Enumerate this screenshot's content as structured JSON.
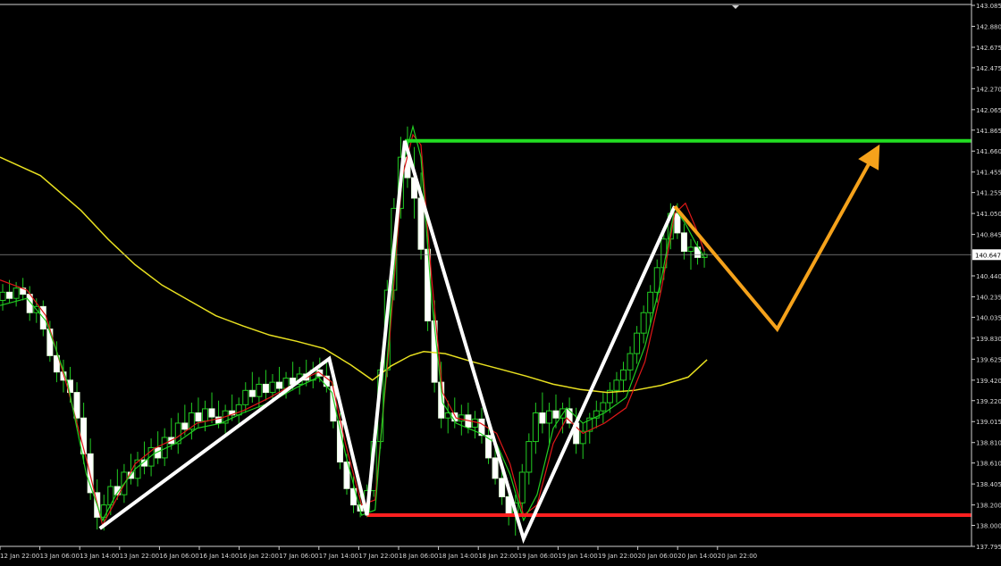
{
  "chart_data": {
    "type": "candlestick",
    "instrument_note": "",
    "y_axis": {
      "ylim": [
        137.795,
        143.085
      ],
      "tick_labels": [
        "143.085",
        "142.880",
        "142.675",
        "142.475",
        "142.270",
        "142.065",
        "141.865",
        "141.660",
        "141.455",
        "141.255",
        "141.050",
        "140.845",
        "140.440",
        "140.235",
        "140.035",
        "139.830",
        "139.625",
        "139.420",
        "139.220",
        "139.015",
        "138.810",
        "138.610",
        "138.405",
        "138.200",
        "138.000",
        "137.795"
      ],
      "current_price": "140.647"
    },
    "x_axis": {
      "tick_labels": [
        "12 Jan 22:00",
        "13 Jan 06:00",
        "13 Jan 14:00",
        "13 Jan 22:00",
        "16 Jan 06:00",
        "16 Jan 14:00",
        "16 Jan 22:00",
        "17 Jan 06:00",
        "17 Jan 14:00",
        "17 Jan 22:00",
        "18 Jan 06:00",
        "18 Jan 14:00",
        "18 Jan 22:00",
        "19 Jan 06:00",
        "19 Jan 14:00",
        "19 Jan 22:00",
        "20 Jan 06:00",
        "20 Jan 14:00",
        "20 Jan 22:00"
      ]
    },
    "levels": [
      {
        "name": "resistance",
        "price": 141.76,
        "color": "#22dd22"
      },
      {
        "name": "support",
        "price": 138.1,
        "color": "#ff2020"
      }
    ],
    "zigzag": {
      "color": "#ffffff",
      "points": [
        {
          "t": 3.7,
          "price": 137.97
        },
        {
          "t": 12.2,
          "price": 139.63
        },
        {
          "t": 13.6,
          "price": 138.1
        },
        {
          "t": 15.0,
          "price": 141.76
        },
        {
          "t": 19.4,
          "price": 137.87
        },
        {
          "t": 25.0,
          "price": 141.12
        }
      ]
    },
    "projection": {
      "color": "#f5a21b",
      "points": [
        {
          "t": 25.0,
          "price": 141.12
        },
        {
          "t": 28.8,
          "price": 139.92
        },
        {
          "t": 32.5,
          "price": 141.68
        }
      ]
    },
    "moving_averages": [
      {
        "name": "",
        "color": "#e8e020",
        "points": [
          [
            0,
            141.6
          ],
          [
            1.5,
            141.42
          ],
          [
            3,
            141.08
          ],
          [
            4,
            140.8
          ],
          [
            5,
            140.55
          ],
          [
            6,
            140.35
          ],
          [
            7,
            140.2
          ],
          [
            8,
            140.05
          ],
          [
            9,
            139.95
          ],
          [
            10,
            139.86
          ],
          [
            11,
            139.8
          ],
          [
            12,
            139.73
          ],
          [
            13,
            139.57
          ],
          [
            13.8,
            139.42
          ],
          [
            14.5,
            139.56
          ],
          [
            15.2,
            139.66
          ],
          [
            15.7,
            139.7
          ],
          [
            16.5,
            139.68
          ],
          [
            17.5,
            139.6
          ],
          [
            18.5,
            139.53
          ],
          [
            19.5,
            139.46
          ],
          [
            20.5,
            139.38
          ],
          [
            21.5,
            139.33
          ],
          [
            22.5,
            139.3
          ],
          [
            23.5,
            139.32
          ],
          [
            24.5,
            139.37
          ],
          [
            25.5,
            139.45
          ],
          [
            26.2,
            139.62
          ]
        ]
      },
      {
        "name": "",
        "color": "#e01818",
        "points": [
          [
            0,
            140.4
          ],
          [
            1,
            140.3
          ],
          [
            1.7,
            140.05
          ],
          [
            2.5,
            139.35
          ],
          [
            3.2,
            138.65
          ],
          [
            3.8,
            138.0
          ],
          [
            4.3,
            138.25
          ],
          [
            5,
            138.6
          ],
          [
            5.7,
            138.75
          ],
          [
            6.5,
            138.85
          ],
          [
            7.3,
            139.0
          ],
          [
            8.2,
            139.05
          ],
          [
            9,
            139.12
          ],
          [
            10,
            139.25
          ],
          [
            11,
            139.4
          ],
          [
            11.8,
            139.5
          ],
          [
            12.3,
            139.4
          ],
          [
            12.8,
            138.8
          ],
          [
            13.4,
            138.2
          ],
          [
            13.9,
            138.25
          ],
          [
            14.4,
            139.7
          ],
          [
            14.9,
            141.4
          ],
          [
            15.3,
            141.82
          ],
          [
            15.6,
            141.72
          ],
          [
            16.0,
            140.4
          ],
          [
            16.4,
            139.3
          ],
          [
            16.9,
            139.05
          ],
          [
            17.8,
            139.0
          ],
          [
            18.4,
            138.9
          ],
          [
            18.9,
            138.6
          ],
          [
            19.4,
            138.1
          ],
          [
            19.9,
            138.2
          ],
          [
            20.5,
            138.8
          ],
          [
            21.0,
            139.05
          ],
          [
            21.6,
            138.9
          ],
          [
            22.4,
            139.0
          ],
          [
            23.2,
            139.15
          ],
          [
            23.9,
            139.6
          ],
          [
            24.5,
            140.3
          ],
          [
            25.0,
            141.05
          ],
          [
            25.4,
            141.15
          ],
          [
            25.8,
            140.9
          ],
          [
            26.1,
            140.68
          ]
        ]
      },
      {
        "name": "",
        "color": "#22cc22",
        "points": [
          [
            0,
            140.15
          ],
          [
            1,
            140.22
          ],
          [
            1.7,
            140.0
          ],
          [
            2.5,
            139.4
          ],
          [
            3.2,
            138.5
          ],
          [
            3.8,
            138.05
          ],
          [
            4.3,
            138.3
          ],
          [
            5,
            138.55
          ],
          [
            5.7,
            138.7
          ],
          [
            6.5,
            138.8
          ],
          [
            7.3,
            138.95
          ],
          [
            8.2,
            139.0
          ],
          [
            9,
            139.1
          ],
          [
            10,
            139.2
          ],
          [
            11,
            139.35
          ],
          [
            11.8,
            139.45
          ],
          [
            12.3,
            139.3
          ],
          [
            12.8,
            138.7
          ],
          [
            13.4,
            138.1
          ],
          [
            13.9,
            138.15
          ],
          [
            14.4,
            139.8
          ],
          [
            14.9,
            141.5
          ],
          [
            15.3,
            141.9
          ],
          [
            15.6,
            141.6
          ],
          [
            16.0,
            140.2
          ],
          [
            16.4,
            139.2
          ],
          [
            16.9,
            139.0
          ],
          [
            17.8,
            138.9
          ],
          [
            18.4,
            138.8
          ],
          [
            18.9,
            138.5
          ],
          [
            19.4,
            138.05
          ],
          [
            19.9,
            138.3
          ],
          [
            20.5,
            138.95
          ],
          [
            21.0,
            139.15
          ],
          [
            21.6,
            139.0
          ],
          [
            22.4,
            139.1
          ],
          [
            23.2,
            139.25
          ],
          [
            23.9,
            139.75
          ],
          [
            24.5,
            140.4
          ],
          [
            25.0,
            141.1
          ],
          [
            25.4,
            140.95
          ],
          [
            25.8,
            140.75
          ],
          [
            26.1,
            140.62
          ]
        ]
      }
    ],
    "candles": [
      [
        0.1,
        140.2,
        140.36,
        140.1,
        140.28
      ],
      [
        0.35,
        140.28,
        140.4,
        140.18,
        140.22
      ],
      [
        0.6,
        140.22,
        140.38,
        140.14,
        140.32
      ],
      [
        0.85,
        140.32,
        140.42,
        140.2,
        140.26
      ],
      [
        1.1,
        140.26,
        140.34,
        140.0,
        140.08
      ],
      [
        1.35,
        140.08,
        140.22,
        139.98,
        140.14
      ],
      [
        1.6,
        140.14,
        140.2,
        139.85,
        139.92
      ],
      [
        1.85,
        139.92,
        140.0,
        139.6,
        139.66
      ],
      [
        2.1,
        139.66,
        139.8,
        139.4,
        139.5
      ],
      [
        2.35,
        139.5,
        139.62,
        139.3,
        139.42
      ],
      [
        2.6,
        139.42,
        139.55,
        139.2,
        139.3
      ],
      [
        2.85,
        139.3,
        139.4,
        138.95,
        139.05
      ],
      [
        3.1,
        139.05,
        139.2,
        138.6,
        138.7
      ],
      [
        3.35,
        138.7,
        138.85,
        138.25,
        138.32
      ],
      [
        3.6,
        138.32,
        138.45,
        137.96,
        138.08
      ],
      [
        3.85,
        138.08,
        138.3,
        137.95,
        138.2
      ],
      [
        4.1,
        138.2,
        138.45,
        138.1,
        138.38
      ],
      [
        4.35,
        138.38,
        138.55,
        138.25,
        138.3
      ],
      [
        4.6,
        138.3,
        138.6,
        138.22,
        138.52
      ],
      [
        4.85,
        138.52,
        138.7,
        138.4,
        138.46
      ],
      [
        5.1,
        138.46,
        138.72,
        138.38,
        138.64
      ],
      [
        5.35,
        138.64,
        138.82,
        138.5,
        138.58
      ],
      [
        5.6,
        138.58,
        138.85,
        138.48,
        138.76
      ],
      [
        5.85,
        138.76,
        138.92,
        138.6,
        138.66
      ],
      [
        6.1,
        138.66,
        138.95,
        138.58,
        138.86
      ],
      [
        6.35,
        138.86,
        139.05,
        138.74,
        138.8
      ],
      [
        6.6,
        138.8,
        139.1,
        138.7,
        139.0
      ],
      [
        6.85,
        139.0,
        139.18,
        138.88,
        138.94
      ],
      [
        7.1,
        138.94,
        139.2,
        138.84,
        139.1
      ],
      [
        7.35,
        139.1,
        139.25,
        138.96,
        139.02
      ],
      [
        7.6,
        139.02,
        139.22,
        138.92,
        139.14
      ],
      [
        7.85,
        139.14,
        139.3,
        139.0,
        139.06
      ],
      [
        8.1,
        139.06,
        139.22,
        138.95,
        139.0
      ],
      [
        8.35,
        139.0,
        139.18,
        138.9,
        139.12
      ],
      [
        8.6,
        139.12,
        139.28,
        139.02,
        139.08
      ],
      [
        8.85,
        139.08,
        139.25,
        138.98,
        139.18
      ],
      [
        9.1,
        139.18,
        139.4,
        139.1,
        139.32
      ],
      [
        9.35,
        139.32,
        139.5,
        139.2,
        139.26
      ],
      [
        9.6,
        139.26,
        139.45,
        139.15,
        139.38
      ],
      [
        9.85,
        139.38,
        139.52,
        139.22,
        139.3
      ],
      [
        10.1,
        139.3,
        139.48,
        139.2,
        139.4
      ],
      [
        10.35,
        139.4,
        139.55,
        139.28,
        139.34
      ],
      [
        10.6,
        139.34,
        139.5,
        139.24,
        139.44
      ],
      [
        10.85,
        139.44,
        139.6,
        139.32,
        139.38
      ],
      [
        11.1,
        139.38,
        139.55,
        139.28,
        139.48
      ],
      [
        11.35,
        139.48,
        139.62,
        139.36,
        139.42
      ],
      [
        11.6,
        139.42,
        139.6,
        139.34,
        139.52
      ],
      [
        11.85,
        139.52,
        139.64,
        139.4,
        139.46
      ],
      [
        12.1,
        139.46,
        139.6,
        139.3,
        139.36
      ],
      [
        12.35,
        139.36,
        139.45,
        138.95,
        139.02
      ],
      [
        12.6,
        139.02,
        139.1,
        138.55,
        138.62
      ],
      [
        12.85,
        138.62,
        138.7,
        138.3,
        138.36
      ],
      [
        13.1,
        138.36,
        138.48,
        138.12,
        138.2
      ],
      [
        13.35,
        138.2,
        138.3,
        138.08,
        138.14
      ],
      [
        13.6,
        138.14,
        138.4,
        138.08,
        138.34
      ],
      [
        13.85,
        138.34,
        138.9,
        138.28,
        138.82
      ],
      [
        14.1,
        138.82,
        139.6,
        138.75,
        139.52
      ],
      [
        14.35,
        139.52,
        140.4,
        139.45,
        140.3
      ],
      [
        14.6,
        140.3,
        141.2,
        140.2,
        141.1
      ],
      [
        14.85,
        141.1,
        141.8,
        141.0,
        141.6
      ],
      [
        15.1,
        141.6,
        141.9,
        141.3,
        141.4
      ],
      [
        15.35,
        141.4,
        141.7,
        141.0,
        141.2
      ],
      [
        15.6,
        141.2,
        141.45,
        140.6,
        140.7
      ],
      [
        15.85,
        140.7,
        140.9,
        139.9,
        140.0
      ],
      [
        16.1,
        140.0,
        140.2,
        139.3,
        139.4
      ],
      [
        16.35,
        139.4,
        139.6,
        138.95,
        139.05
      ],
      [
        16.6,
        139.05,
        139.22,
        138.9,
        139.1
      ],
      [
        16.85,
        139.1,
        139.25,
        138.95,
        139.02
      ],
      [
        17.1,
        139.02,
        139.18,
        138.88,
        139.08
      ],
      [
        17.35,
        139.08,
        139.2,
        138.9,
        138.96
      ],
      [
        17.6,
        138.96,
        139.12,
        138.85,
        139.04
      ],
      [
        17.85,
        139.04,
        139.15,
        138.8,
        138.88
      ],
      [
        18.1,
        138.88,
        139.0,
        138.6,
        138.66
      ],
      [
        18.35,
        138.66,
        138.8,
        138.4,
        138.46
      ],
      [
        18.6,
        138.46,
        138.6,
        138.2,
        138.28
      ],
      [
        18.85,
        138.28,
        138.4,
        138.0,
        138.1
      ],
      [
        19.1,
        138.1,
        138.3,
        137.9,
        138.22
      ],
      [
        19.35,
        138.22,
        138.6,
        138.1,
        138.52
      ],
      [
        19.6,
        138.52,
        138.9,
        138.4,
        138.82
      ],
      [
        19.85,
        138.82,
        139.2,
        138.7,
        139.1
      ],
      [
        20.1,
        139.1,
        139.3,
        138.9,
        139.0
      ],
      [
        20.35,
        139.0,
        139.2,
        138.8,
        139.12
      ],
      [
        20.6,
        139.12,
        139.28,
        138.95,
        139.05
      ],
      [
        20.85,
        139.05,
        139.2,
        138.9,
        139.14
      ],
      [
        21.1,
        139.14,
        139.25,
        138.95,
        139.0
      ],
      [
        21.35,
        139.0,
        139.15,
        138.7,
        138.8
      ],
      [
        21.6,
        138.8,
        139.0,
        138.65,
        138.92
      ],
      [
        21.85,
        138.92,
        139.1,
        138.8,
        139.05
      ],
      [
        22.1,
        139.05,
        139.22,
        138.95,
        139.12
      ],
      [
        22.35,
        139.12,
        139.3,
        139.0,
        139.2
      ],
      [
        22.6,
        139.2,
        139.4,
        139.1,
        139.32
      ],
      [
        22.85,
        139.32,
        139.5,
        139.2,
        139.42
      ],
      [
        23.1,
        139.42,
        139.6,
        139.3,
        139.52
      ],
      [
        23.35,
        139.52,
        139.75,
        139.42,
        139.68
      ],
      [
        23.6,
        139.68,
        139.95,
        139.58,
        139.88
      ],
      [
        23.85,
        139.88,
        140.15,
        139.78,
        140.08
      ],
      [
        24.1,
        140.08,
        140.35,
        139.98,
        140.28
      ],
      [
        24.35,
        140.28,
        140.6,
        140.18,
        140.52
      ],
      [
        24.6,
        140.52,
        140.9,
        140.4,
        140.8
      ],
      [
        24.85,
        140.8,
        141.15,
        140.7,
        141.05
      ],
      [
        25.1,
        141.05,
        141.15,
        140.8,
        140.86
      ],
      [
        25.35,
        140.86,
        140.95,
        140.6,
        140.68
      ],
      [
        25.6,
        140.68,
        140.8,
        140.5,
        140.72
      ],
      [
        25.85,
        140.72,
        140.78,
        140.55,
        140.62
      ],
      [
        26.1,
        140.62,
        140.7,
        140.52,
        140.65
      ]
    ]
  }
}
